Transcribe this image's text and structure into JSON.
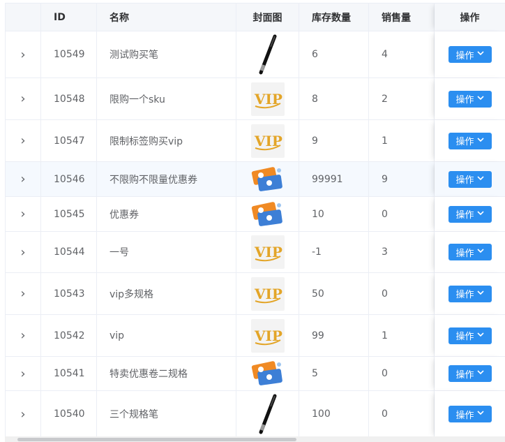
{
  "table": {
    "headers": {
      "id": "ID",
      "name": "名称",
      "cover": "封面图",
      "stock": "库存数量",
      "sales": "销售量",
      "actions": "操作"
    },
    "action_label": "操作",
    "rows": [
      {
        "id": "10549",
        "name": "测试购买笔",
        "cover": "pen",
        "stock": "6",
        "sales": "4"
      },
      {
        "id": "10548",
        "name": "限购一个sku",
        "cover": "vip",
        "stock": "8",
        "sales": "2"
      },
      {
        "id": "10547",
        "name": "限制标签购买vip",
        "cover": "vip",
        "stock": "9",
        "sales": "1"
      },
      {
        "id": "10546",
        "name": "不限购不限量优惠券",
        "cover": "coupon",
        "stock": "99991",
        "sales": "9"
      },
      {
        "id": "10545",
        "name": "优惠券",
        "cover": "coupon",
        "stock": "10",
        "sales": "0"
      },
      {
        "id": "10544",
        "name": "一号",
        "cover": "vip",
        "stock": "-1",
        "sales": "3"
      },
      {
        "id": "10543",
        "name": "vip多规格",
        "cover": "vip",
        "stock": "50",
        "sales": "0"
      },
      {
        "id": "10542",
        "name": "vip",
        "cover": "vip",
        "stock": "99",
        "sales": "1"
      },
      {
        "id": "10541",
        "name": "特卖优惠卷二规格",
        "cover": "coupon",
        "stock": "5",
        "sales": "0"
      },
      {
        "id": "10540",
        "name": "三个规格笔",
        "cover": "pen",
        "stock": "100",
        "sales": "0"
      }
    ]
  },
  "colors": {
    "accent": "#2b8ef0",
    "header_bg": "#f5f7fa",
    "highlight_row": "#f5f9fe"
  }
}
